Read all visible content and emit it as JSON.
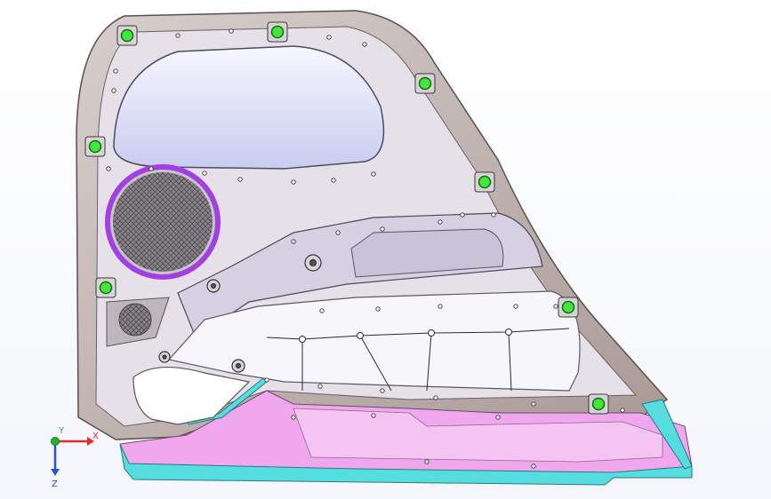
{
  "triad": {
    "x_label": "X",
    "y_label": "Y",
    "z_label": "Z"
  },
  "colors": {
    "panel_shell": "#b9aaa6",
    "panel_inner": "#ece7ef",
    "map_pocket": "#cfd2f2",
    "window_pocket": "#f4f4ff",
    "speaker_ring": "#a23fe0",
    "speaker_mesh": "#7e7a80",
    "clip_mount": "#43e63a",
    "lower_trim": "#f0a7ee",
    "edge_band": "#55dde0",
    "axis_x": "#e22b2b",
    "axis_y": "#22b52b",
    "axis_z": "#2b4fd8"
  },
  "model": {
    "part": "door-trim-panel",
    "mounting_clips": 8,
    "speakers": 2
  }
}
